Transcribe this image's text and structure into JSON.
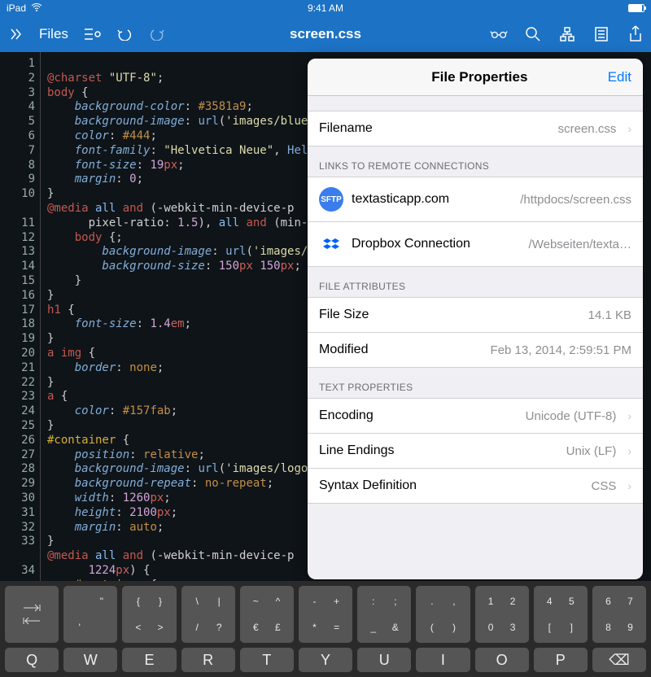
{
  "status": {
    "device": "iPad",
    "time": "9:41 AM"
  },
  "toolbar": {
    "files": "Files",
    "title": "screen.css"
  },
  "gutter_lines": [
    "1",
    "2",
    "3",
    "4",
    "5",
    "6",
    "7",
    "8",
    "9",
    "10",
    "",
    "11",
    "12",
    "13",
    "14",
    "15",
    "16",
    "17",
    "18",
    "19",
    "20",
    "21",
    "22",
    "23",
    "24",
    "25",
    "26",
    "27",
    "28",
    "29",
    "30",
    "31",
    "32",
    "33",
    "",
    "34"
  ],
  "code": {
    "l1a": "@charset",
    "l1b": " \"UTF-8\"",
    "l1c": ";",
    "l2a": "body",
    "l2b": " {",
    "l3a": "    background-color",
    "l3b": ": ",
    "l3c": "#3581a9",
    "l3d": ";",
    "l4a": "    background-image",
    "l4b": ": ",
    "l4c": "url",
    "l4d": "(",
    "l4e": "'images/blue",
    "l4f": "",
    "l5a": "    color",
    "l5b": ": ",
    "l5c": "#444",
    "l5d": ";",
    "l6a": "    font-family",
    "l6b": ": ",
    "l6c": "\"Helvetica Neue\"",
    "l6d": ", ",
    "l6e": "Hel",
    "l7a": "    font-size",
    "l7b": ": ",
    "l7c": "19",
    "l7d": "px",
    "l7e": ";",
    "l8a": "    margin",
    "l8b": ": ",
    "l8c": "0",
    "l8d": ";",
    "l9a": "}",
    "l10a": "@media",
    "l10b": " all ",
    "l10c": "and",
    "l10d": " (-webkit-min-device-p",
    "l10ea": "      pixel-ratio: ",
    "l10eb": "1.5",
    "l10ec": "), ",
    "l10ed": "all ",
    "l10ee": "and",
    "l10ef": " (min-",
    "l11a": "    body",
    "l11b": " {;",
    "l12a": "        background-image",
    "l12b": ": ",
    "l12c": "url",
    "l12d": "(",
    "l12e": "'images/bl",
    "l13a": "        background-size",
    "l13b": ": ",
    "l13c": "150",
    "l13d": "px ",
    "l13e": "150",
    "l13f": "px",
    "l13g": ";",
    "l14a": "    }",
    "l15a": "}",
    "l16a": "h1",
    "l16b": " {",
    "l17a": "    font-size",
    "l17b": ": ",
    "l17c": "1.4",
    "l17d": "em",
    "l17e": ";",
    "l18a": "}",
    "l19a": "a img",
    "l19b": " {",
    "l20a": "    border",
    "l20b": ": ",
    "l20c": "none",
    "l20d": ";",
    "l21a": "}",
    "l22a": "a",
    "l22b": " {",
    "l23a": "    color",
    "l23b": ": ",
    "l23c": "#157fab",
    "l23d": ";",
    "l24a": "}",
    "l25a": "#container",
    "l25b": " {",
    "l26a": "    position",
    "l26b": ": ",
    "l26c": "relative",
    "l26d": ";",
    "l27a": "    background-image",
    "l27b": ": ",
    "l27c": "url",
    "l27d": "(",
    "l27e": "'images/logo",
    "l28a": "    background-repeat",
    "l28b": ": ",
    "l28c": "no-repeat",
    "l28d": ";",
    "l29a": "    width",
    "l29b": ": ",
    "l29c": "1260",
    "l29d": "px",
    "l29e": ";",
    "l30a": "    height",
    "l30b": ": ",
    "l30c": "2100",
    "l30d": "px",
    "l30e": ";",
    "l31a": "    margin",
    "l31b": ": ",
    "l31c": "auto",
    "l31d": ";",
    "l32a": "}",
    "l33a": "@media",
    "l33b": " all ",
    "l33c": "and",
    "l33d": " (-webkit-min-device-p",
    "l33ea": "      1224",
    "l33eb": "px",
    "l33ec": ") {",
    "l34a": "    #container",
    "l34b": " {"
  },
  "popover": {
    "title": "File Properties",
    "edit": "Edit",
    "filename_label": "Filename",
    "filename_value": "screen.css",
    "links_header": "LINKS TO REMOTE CONNECTIONS",
    "conn1_label": "textasticapp.com",
    "conn1_path": "/httpdocs/screen.css",
    "conn1_icon": "SFTP",
    "conn2_label": "Dropbox Connection",
    "conn2_path": "/Webseiten/texta…",
    "attrs_header": "FILE ATTRIBUTES",
    "size_label": "File Size",
    "size_value": "14.1 KB",
    "modified_label": "Modified",
    "modified_value": "Feb 13, 2014, 2:59:51 PM",
    "text_header": "TEXT PROPERTIES",
    "encoding_label": "Encoding",
    "encoding_value": "Unicode (UTF-8)",
    "endings_label": "Line Endings",
    "endings_value": "Unix (LF)",
    "syntax_label": "Syntax Definition",
    "syntax_value": "CSS"
  },
  "keyboard": {
    "row1": [
      {
        "tl": "",
        "tr": "\"",
        "bl": "'",
        "br": ""
      },
      {
        "tl": "{",
        "tr": "}",
        "bl": "<",
        "br": ">"
      },
      {
        "tl": "\\",
        "tr": "|",
        "bl": "/",
        "br": "?"
      },
      {
        "tl": "~",
        "tr": "^",
        "bl": "€",
        "br": "£"
      },
      {
        "tl": "-",
        "tr": "+",
        "bl": "*",
        "br": "="
      },
      {
        "tl": ":",
        "tr": ";",
        "bl": "_",
        "br": "&"
      },
      {
        "tl": ".",
        "tr": ",",
        "bl": "(",
        "br": ")"
      },
      {
        "tl": "1",
        "tr": "2",
        "bl": "0",
        "br": "3"
      },
      {
        "tl": "4",
        "tr": "5",
        "bl": "[",
        "br": "]"
      },
      {
        "tl": "6",
        "tr": "7",
        "bl": "8",
        "br": "9"
      }
    ],
    "row2": [
      "Q",
      "W",
      "E",
      "R",
      "T",
      "Y",
      "U",
      "I",
      "O",
      "P",
      "⌫"
    ]
  }
}
